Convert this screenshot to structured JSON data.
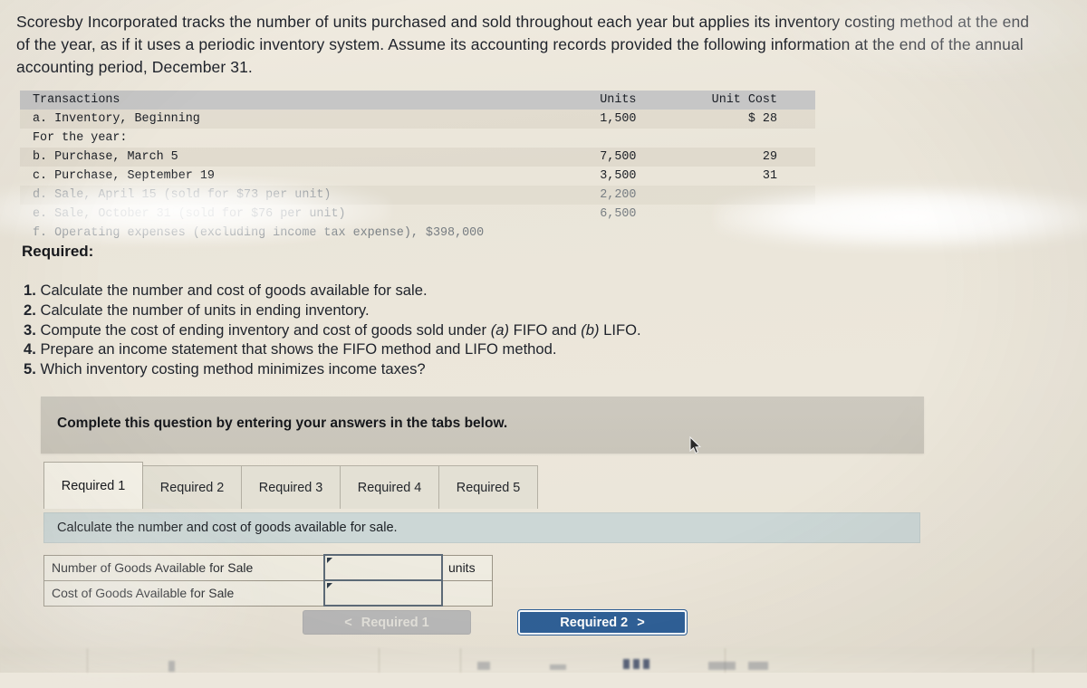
{
  "intro": {
    "paragraph": "Scoresby Incorporated tracks the number of units purchased and sold throughout each year but applies its inventory costing method at the end of the year, as if it uses a periodic inventory system. Assume its accounting records provided the following information at the end of the annual accounting period, December 31."
  },
  "transactions_table": {
    "headers": {
      "transactions": "Transactions",
      "units": "Units",
      "unit_cost": "Unit Cost"
    },
    "rows": [
      {
        "label": "a. Inventory, Beginning",
        "units": "1,500",
        "unit_cost": "$ 28",
        "faded": false,
        "shade": true
      },
      {
        "label": "For the year:",
        "units": "",
        "unit_cost": "",
        "faded": false,
        "shade": false
      },
      {
        "label": "b. Purchase, March 5",
        "units": "7,500",
        "unit_cost": "29",
        "faded": false,
        "shade": true
      },
      {
        "label": "c. Purchase, September 19",
        "units": "3,500",
        "unit_cost": "31",
        "faded": false,
        "shade": false
      },
      {
        "label": "d. Sale, April 15 (sold for $73 per unit)",
        "units": "2,200",
        "unit_cost": "",
        "faded": true,
        "shade": true
      },
      {
        "label": "e. Sale, October 31 (sold for $76 per unit)",
        "units": "6,500",
        "unit_cost": "",
        "faded": true,
        "shade": false
      },
      {
        "label": "f. Operating expenses (excluding income tax expense), $398,000",
        "units": "",
        "unit_cost": "",
        "faded": true,
        "shade": false
      }
    ]
  },
  "required": {
    "heading": "Required:",
    "items": [
      {
        "number": "1.",
        "text": "Calculate the number and cost of goods available for sale."
      },
      {
        "number": "2.",
        "text": "Calculate the number of units in ending inventory."
      },
      {
        "number": "3.",
        "text": "Compute the cost of ending inventory and cost of goods sold under (a) FIFO and (b) LIFO.",
        "italic_a": "(a)",
        "italic_b": "(b)"
      },
      {
        "number": "4.",
        "text": "Prepare an income statement that shows the FIFO method and LIFO method."
      },
      {
        "number": "5.",
        "text": "Which inventory costing method minimizes income taxes?"
      }
    ]
  },
  "banner": {
    "text": "Complete this question by entering your answers in the tabs below."
  },
  "tabs": {
    "items": [
      {
        "label": "Required 1",
        "active": true
      },
      {
        "label": "Required 2",
        "active": false
      },
      {
        "label": "Required 3",
        "active": false
      },
      {
        "label": "Required 4",
        "active": false
      },
      {
        "label": "Required 5",
        "active": false
      }
    ]
  },
  "answer_panel": {
    "subheader": "Calculate the number and cost of goods available for sale.",
    "rows": [
      {
        "label": "Number of Goods Available for Sale",
        "value": "",
        "unit": "units"
      },
      {
        "label": "Cost of Goods Available for Sale",
        "value": "",
        "unit": ""
      }
    ]
  },
  "nav": {
    "prev_chevron": "<",
    "prev_label": "Required 1",
    "next_label": "Required 2",
    "next_chevron": ">"
  },
  "colors": {
    "page_background": "#ece7dc",
    "table_header": "#c6c6c6",
    "banner": "#cdc9bf",
    "subheader": "#ccd7d6",
    "tab_active": "#f4f1e7",
    "tab_inactive": "#e3e0d4",
    "primary_button": "#2f6097",
    "disabled_button": "#b9b9b9",
    "input_border": "#5d6b78"
  }
}
